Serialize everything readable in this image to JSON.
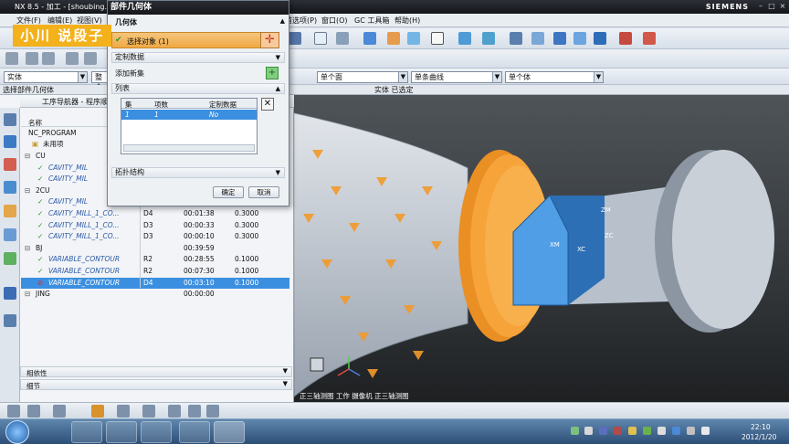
{
  "title_bar": {
    "app": "NX 8.5 - 加工 - [shoubing.p",
    "brand": "SIEMENS"
  },
  "menu": {
    "file": "文件(F)",
    "edit": "编辑(E)",
    "view": "视图(V)",
    "preferences": "首选项(P)",
    "window": "窗口(O)",
    "gc_toolbox": "GC 工具箱",
    "help": "帮助(H)"
  },
  "selection_bar": {
    "filter": "实体",
    "scope": "整个",
    "face_rule": "单个面",
    "curve_rule": "单条曲线",
    "body_rule": "单个体"
  },
  "prompt": {
    "left": "选择部件几何体",
    "center": "实体 已选定"
  },
  "watermark": "小川 说段子",
  "dialog": {
    "title": "部件几何体",
    "section_geometry": "几何体",
    "select_object": "选择对象 (1)",
    "custom_data": "定制数据",
    "add_new_set": "添加新集",
    "list_header": "列表",
    "list_columns": [
      "集",
      "项数",
      "定制数据"
    ],
    "list_row": [
      "1",
      "1",
      "No"
    ],
    "topology": "拓扑结构",
    "ok": "确定",
    "cancel": "取消"
  },
  "navigator": {
    "title": "工序导航器 - 程序顺",
    "col_name": "名称",
    "root": "NC_PROGRAM",
    "unused": "未用项",
    "rows": [
      {
        "name": "CU",
        "kind": "group",
        "tool": "",
        "time": "",
        "stock": ""
      },
      {
        "name": "CAVITY_MIL",
        "kind": "op",
        "tool": "",
        "time": "",
        "stock": ""
      },
      {
        "name": "CAVITY_MIL",
        "kind": "op",
        "tool": "",
        "time": "",
        "stock": ""
      },
      {
        "name": "2CU",
        "kind": "group",
        "tool": "",
        "time": "",
        "stock": ""
      },
      {
        "name": "CAVITY_MIL",
        "kind": "op",
        "tool": "",
        "time": "",
        "stock": ""
      },
      {
        "name": "CAVITY_MILL_1_CO...",
        "kind": "op2",
        "tool": "D4",
        "time": "00:01:38",
        "stock": "0.3000"
      },
      {
        "name": "CAVITY_MILL_1_CO...",
        "kind": "op2",
        "tool": "D3",
        "time": "00:00:33",
        "stock": "0.3000"
      },
      {
        "name": "CAVITY_MILL_1_CO...",
        "kind": "op2",
        "tool": "D3",
        "time": "00:00:10",
        "stock": "0.3000"
      },
      {
        "name": "BJ",
        "kind": "group",
        "tool": "",
        "time": "00:39:59",
        "stock": ""
      },
      {
        "name": "VARIABLE_CONTOUR",
        "kind": "op",
        "tool": "R2",
        "time": "00:28:55",
        "stock": "0.1000"
      },
      {
        "name": "VARIABLE_CONTOUR",
        "kind": "op2",
        "tool": "R2",
        "time": "00:07:30",
        "stock": "0.1000"
      },
      {
        "name": "VARIABLE_CONTOUR",
        "kind": "sel",
        "tool": "D4",
        "time": "00:03:10",
        "stock": "0.1000"
      },
      {
        "name": "JING",
        "kind": "group",
        "tool": "",
        "time": "00:00:00",
        "stock": ""
      }
    ],
    "dependencies": "相依性",
    "details": "细节"
  },
  "viewport": {
    "status": "正三轴测图 工作 摄像机 正三轴测图",
    "axis_labels": [
      "ZM",
      "ZC",
      "XC",
      "XM"
    ],
    "colors": {
      "background_top": "#4f5459",
      "part_gray": "#c4ccd6",
      "part_blue": "#3e8edc",
      "part_orange": "#f39a2a"
    }
  },
  "taskbar": {
    "clock": "22:10",
    "date": "2012/1/20"
  }
}
